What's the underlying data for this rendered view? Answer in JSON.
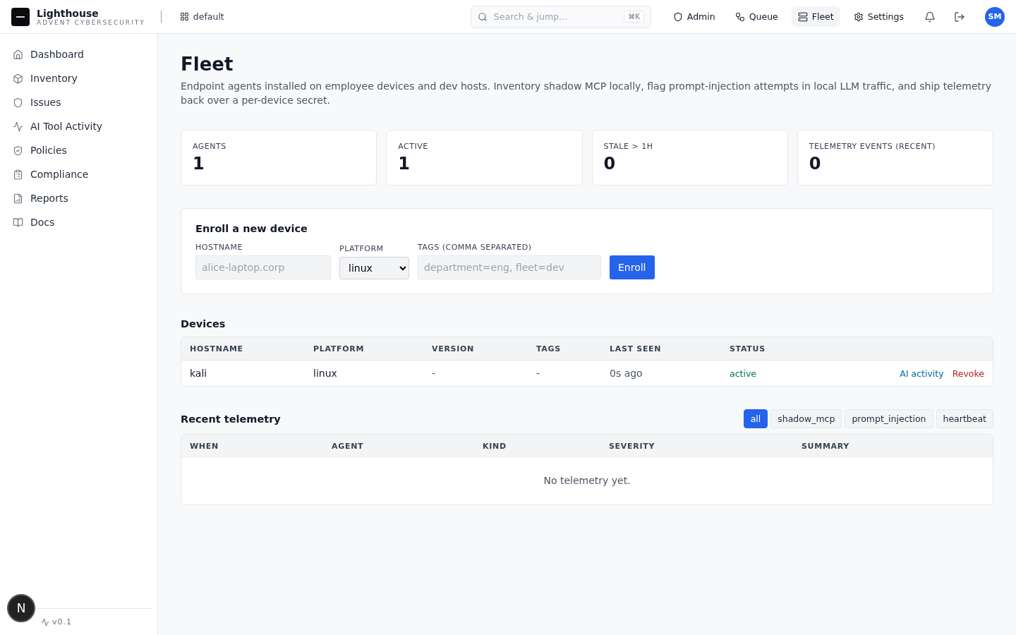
{
  "brand": {
    "name": "Lighthouse",
    "tagline": "ADVENT CYBERSECURITY",
    "workspace": "default"
  },
  "search": {
    "placeholder": "Search & jump...",
    "shortcut": "⌘K"
  },
  "top_nav": [
    {
      "label": "Admin",
      "selected": false
    },
    {
      "label": "Queue",
      "selected": false
    },
    {
      "label": "Fleet",
      "selected": true
    },
    {
      "label": "Settings",
      "selected": false
    }
  ],
  "user": {
    "initials": "SM"
  },
  "sidebar": {
    "items": [
      {
        "label": "Dashboard",
        "selected": false
      },
      {
        "label": "Inventory",
        "selected": false
      },
      {
        "label": "Issues",
        "selected": false
      },
      {
        "label": "AI Tool Activity",
        "selected": false
      },
      {
        "label": "Policies",
        "selected": false
      },
      {
        "label": "Compliance",
        "selected": false
      },
      {
        "label": "Reports",
        "selected": false
      },
      {
        "label": "Docs",
        "selected": false
      }
    ],
    "version": "v0.1",
    "dev_badge": "N"
  },
  "page": {
    "title": "Fleet",
    "description": "Endpoint agents installed on employee devices and dev hosts. Inventory shadow MCP locally, flag prompt-injection attempts in local LLM traffic, and ship telemetry back over a per-device secret."
  },
  "stats": [
    {
      "label": "AGENTS",
      "value": "1"
    },
    {
      "label": "ACTIVE",
      "value": "1"
    },
    {
      "label": "STALE > 1H",
      "value": "0"
    },
    {
      "label": "TELEMETRY EVENTS (RECENT)",
      "value": "0"
    }
  ],
  "enroll": {
    "title": "Enroll a new device",
    "hostname": {
      "label": "HOSTNAME",
      "placeholder": "alice-laptop.corp"
    },
    "platform": {
      "label": "PLATFORM",
      "value": "linux"
    },
    "tags": {
      "label": "TAGS (COMMA SEPARATED)",
      "placeholder": "department=eng, fleet=dev"
    },
    "button": "Enroll"
  },
  "devices": {
    "title": "Devices",
    "columns": [
      "HOSTNAME",
      "PLATFORM",
      "VERSION",
      "TAGS",
      "LAST SEEN",
      "STATUS"
    ],
    "rows": [
      {
        "hostname": "kali",
        "platform": "linux",
        "version": "-",
        "tags": "-",
        "last_seen": "0s ago",
        "status": "active",
        "actions": [
          "AI activity",
          "Revoke"
        ]
      }
    ]
  },
  "telemetry": {
    "title": "Recent telemetry",
    "filters": [
      {
        "label": "all",
        "selected": true
      },
      {
        "label": "shadow_mcp",
        "selected": false
      },
      {
        "label": "prompt_injection",
        "selected": false
      },
      {
        "label": "heartbeat",
        "selected": false
      }
    ],
    "columns": [
      "WHEN",
      "AGENT",
      "KIND",
      "SEVERITY",
      "SUMMARY"
    ],
    "empty": "No telemetry yet."
  }
}
